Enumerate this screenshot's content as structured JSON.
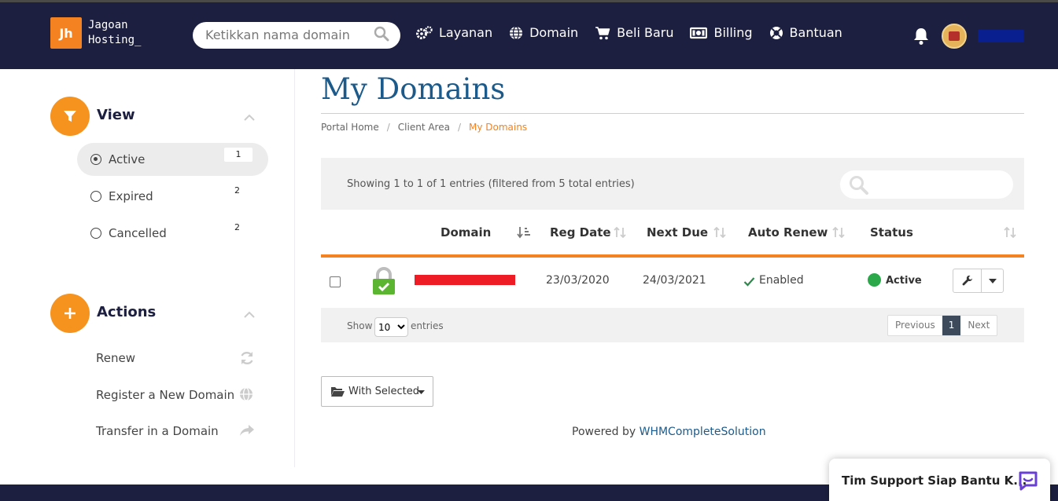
{
  "header": {
    "logo_mark": "Jh",
    "logo_line1": "Jagoan",
    "logo_line2": "Hosting_",
    "search_placeholder": "Ketikkan nama domain",
    "nav": [
      {
        "label": "Layanan",
        "icon": "gears-icon"
      },
      {
        "label": "Domain",
        "icon": "globe-icon"
      },
      {
        "label": "Beli Baru",
        "icon": "cart-icon"
      },
      {
        "label": "Billing",
        "icon": "money-icon"
      },
      {
        "label": "Bantuan",
        "icon": "lifebuoy-icon"
      }
    ]
  },
  "sidebar": {
    "view_title": "View",
    "view_items": [
      {
        "label": "Active",
        "count": "1",
        "selected": true
      },
      {
        "label": "Expired",
        "count": "2",
        "selected": false
      },
      {
        "label": "Cancelled",
        "count": "2",
        "selected": false
      }
    ],
    "actions_title": "Actions",
    "action_items": [
      {
        "label": "Renew",
        "icon": "refresh-icon"
      },
      {
        "label": "Register a New Domain",
        "icon": "globe-icon"
      },
      {
        "label": "Transfer in a Domain",
        "icon": "share-arrow-icon"
      }
    ]
  },
  "main": {
    "title": "My Domains",
    "breadcrumbs": [
      "Portal Home",
      "Client Area",
      "My Domains"
    ],
    "table_info": "Showing 1 to 1 of 1 entries (filtered from 5 total entries)",
    "columns": [
      "Domain",
      "Reg Date",
      "Next Due",
      "Auto Renew",
      "Status"
    ],
    "rows": [
      {
        "reg_date": "23/03/2020",
        "next_due": "24/03/2021",
        "auto_renew": "Enabled",
        "status": "Active"
      }
    ],
    "footer": {
      "show_label": "Show",
      "page_size": "10",
      "entries_label": "entries",
      "previous": "Previous",
      "page": "1",
      "next": "Next"
    },
    "with_selected": "With Selected",
    "powered_prefix": "Powered by",
    "powered_link": "WHMCompleteSolution"
  },
  "chat": {
    "label": "Tim Support Siap Bantu K..."
  },
  "colors": {
    "navbar": "#1c1f3f",
    "accent": "#f58220",
    "title": "#1b5a8a",
    "status_active": "#2aa84a"
  }
}
